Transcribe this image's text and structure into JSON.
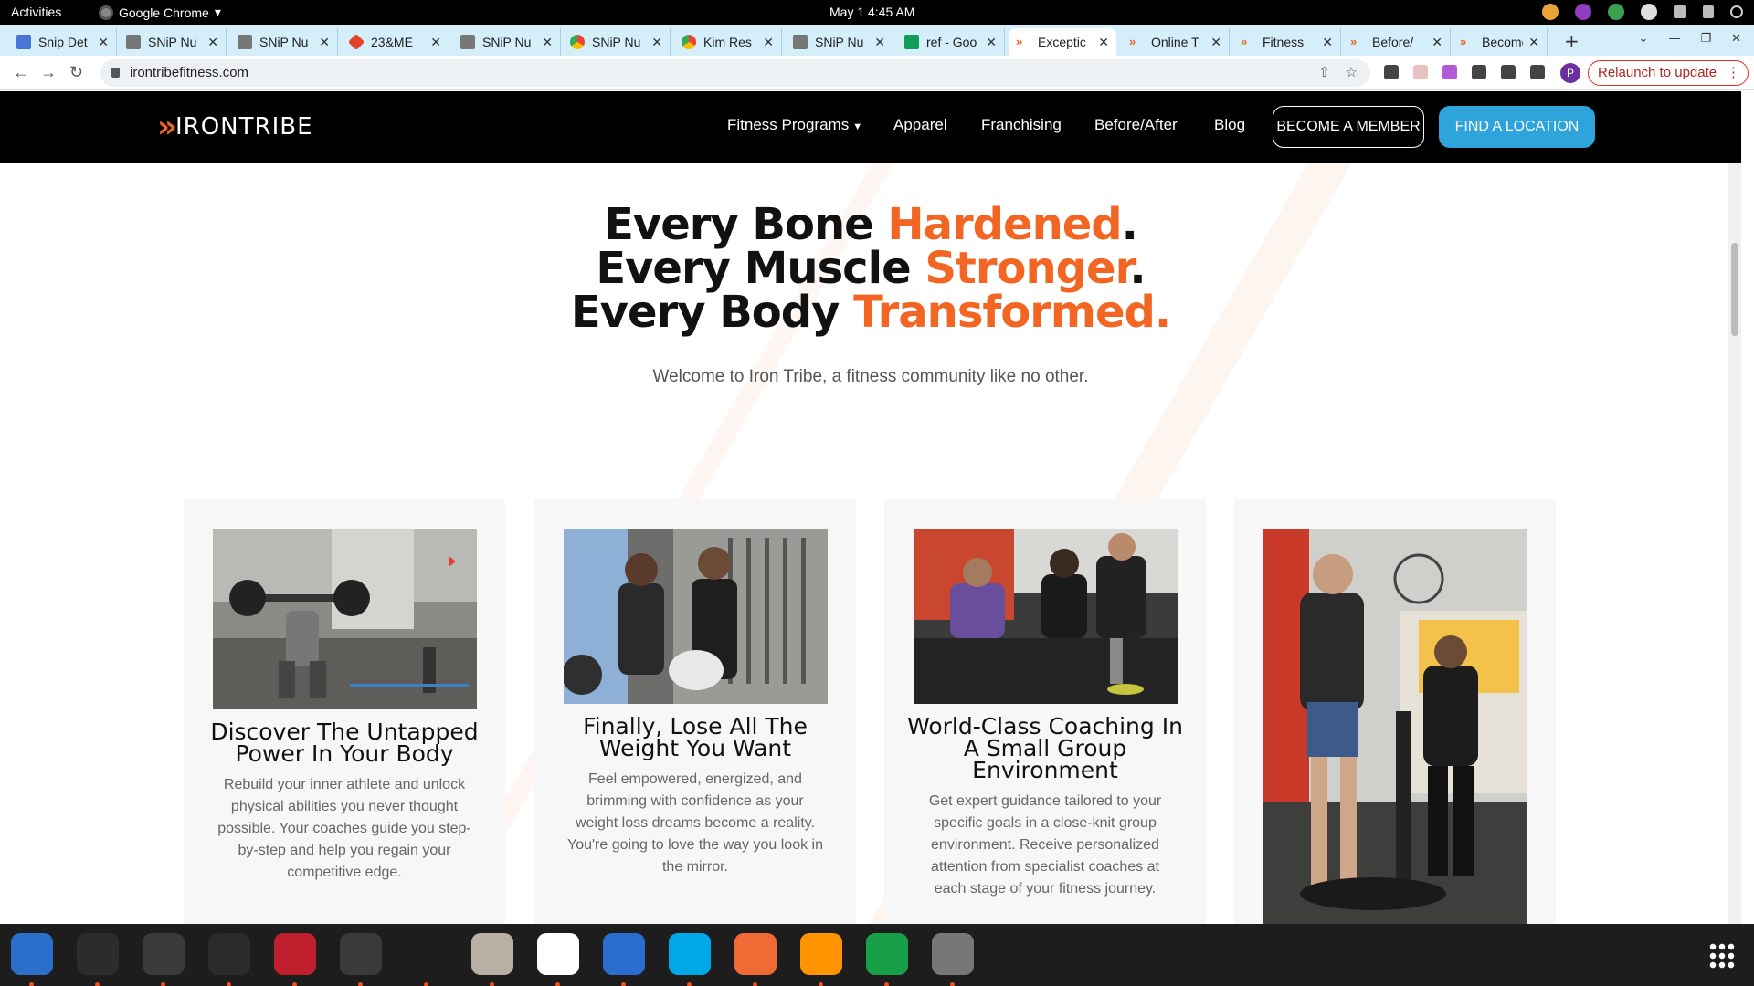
{
  "topbar": {
    "activities": "Activities",
    "app_name": "Google Chrome",
    "clock": "May 1  4:45 AM"
  },
  "tabs": [
    {
      "title": "Snip Det",
      "icon": "doc"
    },
    {
      "title": "SNiP Nu",
      "icon": "snip"
    },
    {
      "title": "SNiP Nu",
      "icon": "snip"
    },
    {
      "title": "23&ME",
      "icon": "gl"
    },
    {
      "title": "SNiP Nu",
      "icon": "snip"
    },
    {
      "title": "SNiP Nu",
      "icon": "cr"
    },
    {
      "title": "Kim Res",
      "icon": "cr"
    },
    {
      "title": "SNiP Nu",
      "icon": "snip"
    },
    {
      "title": "ref - Goo",
      "icon": "sh"
    },
    {
      "title": "Exceptic",
      "icon": "it",
      "active": true
    },
    {
      "title": "Online T",
      "icon": "it"
    },
    {
      "title": "Fitness",
      "icon": "it"
    },
    {
      "title": "Before/",
      "icon": "it"
    },
    {
      "title": "Become",
      "icon": "it"
    }
  ],
  "address_bar": {
    "url": "irontribefitness.com",
    "profile_initial": "P",
    "relaunch_label": "Relaunch to update"
  },
  "site": {
    "logo_text": "IRONTRIBE",
    "nav": {
      "fitness_programs": "Fitness Programs",
      "apparel": "Apparel",
      "franchising": "Franchising",
      "before_after": "Before/After",
      "blog": "Blog",
      "become_member": "BECOME A MEMBER",
      "find_location": "FIND A LOCATION"
    },
    "hero": {
      "line1_plain": "Every Bone ",
      "line1_accent": "Hardened",
      "line2_plain": "Every Muscle ",
      "line2_accent": "Stronger",
      "line3_plain": "Every Body ",
      "line3_accent": "Transformed.",
      "period": ".",
      "tagline": "Welcome to Iron Tribe, a fitness community like no other."
    },
    "cards": [
      {
        "title": "Discover The Untapped Power In Your Body",
        "body": "Rebuild your inner athlete and unlock physical abilities you never thought possible. Your coaches guide you step-by-step and help you regain your competitive edge."
      },
      {
        "title": "Finally, Lose All The Weight You Want",
        "body": "Feel empowered, energized, and brimming with confidence as your weight loss dreams become a reality. You're going to love the way you look in the mirror."
      },
      {
        "title": "World-Class Coaching In A Small Group Environment",
        "body": "Get expert guidance tailored to your specific goals in a close-knit group environment. Receive personalized attention from specialist coaches at each stage of your fitness journey."
      },
      {
        "title": "",
        "body": ""
      }
    ]
  },
  "dock": [
    {
      "name": "thunderbird-icon",
      "color": "#2a6fc9"
    },
    {
      "name": "terminal-icon",
      "color": "#2c2c2c"
    },
    {
      "name": "calculator-icon",
      "color": "#3a3a3a"
    },
    {
      "name": "system-monitor-icon",
      "color": "#2b2b2b"
    },
    {
      "name": "filezilla-icon",
      "color": "#bf1e2d"
    },
    {
      "name": "chrome-icon",
      "color": "#3a3a3a"
    },
    {
      "name": "vscode-icon",
      "color": "#1d1d1d"
    },
    {
      "name": "files-icon",
      "color": "#b8b1a3"
    },
    {
      "name": "text-editor-icon",
      "color": "#ffffff"
    },
    {
      "name": "writer-icon",
      "color": "#2a6dcf"
    },
    {
      "name": "skype-icon",
      "color": "#00a8e8"
    },
    {
      "name": "inkscape-icon",
      "color": "#f06a35"
    },
    {
      "name": "firefox-icon",
      "color": "#ff9400"
    },
    {
      "name": "calc-sheet-icon",
      "color": "#18a048"
    },
    {
      "name": "disk-icon",
      "color": "#777777"
    }
  ]
}
